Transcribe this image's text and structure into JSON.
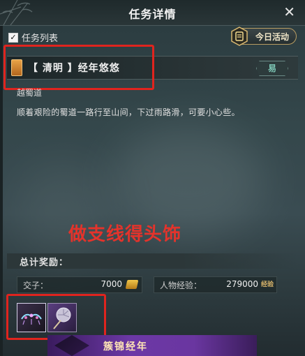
{
  "window": {
    "title": "任务详情",
    "close_label": "✕"
  },
  "task_list": {
    "label": "任务列表",
    "checked": true,
    "check_glyph": "✓"
  },
  "today_activity": {
    "label": "今日活动"
  },
  "quest": {
    "title": "【 清明 】经年悠悠",
    "difficulty": "易",
    "location": "越蜀道",
    "description": "顺着艰险的蜀道一路行至山间，下过雨路滑，可要小心些。"
  },
  "annotation": {
    "text": "做支线得头饰",
    "color": "#e4332b"
  },
  "rewards": {
    "title": "总计奖励：",
    "stats": [
      {
        "label": "交子：",
        "value": "7000",
        "icon": "coin-icon"
      },
      {
        "label": "人物经验：",
        "value": "279000",
        "icon_text": "经验"
      }
    ],
    "items": [
      {
        "name": "headpiece-item-icon"
      },
      {
        "name": "fan-item-icon"
      }
    ]
  },
  "banner": {
    "title": "簇锦经年"
  },
  "colors": {
    "highlight_box": "#e0241e",
    "accent_gold": "#b99d62",
    "difficulty_green": "#7ec9b7"
  }
}
